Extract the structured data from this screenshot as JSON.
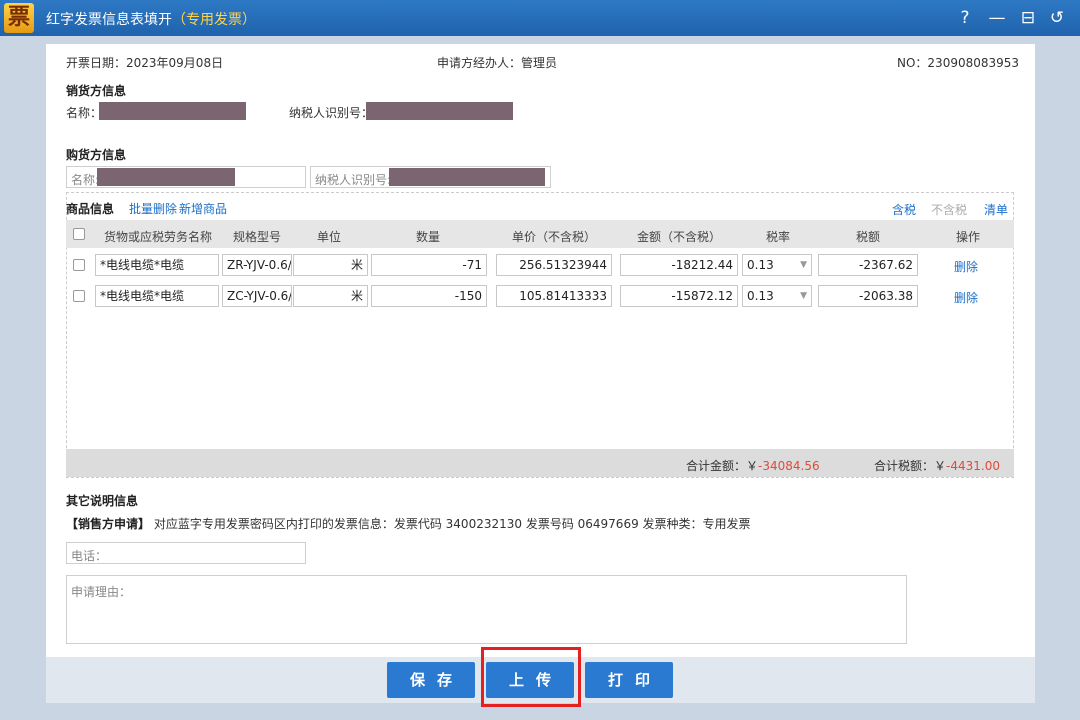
{
  "window": {
    "logo_char": "票",
    "title": "红字发票信息表填开",
    "title_sub": "（专用发票）",
    "help": "?",
    "minimize": "—",
    "restore": "⊟",
    "back": "↺"
  },
  "header": {
    "date": "开票日期：2023年09月08日",
    "applicant": "申请方经办人：管理员",
    "no": "NO：230908083953"
  },
  "seller": {
    "section": "销货方信息",
    "name_label": "名称：",
    "tax_label": "纳税人识别号："
  },
  "buyer": {
    "section": "购货方信息",
    "name_placeholder": "名称:",
    "tax_placeholder": "纳税人识别号:"
  },
  "goods": {
    "section": "商品信息",
    "batch_delete": "批量删除",
    "add_item": "新增商品",
    "with_tax": "含税",
    "without_tax": "不含税",
    "list": "清单",
    "columns": [
      "货物或应税劳务名称",
      "规格型号",
      "单位",
      "数量",
      "单价（不含税）",
      "金额（不含税）",
      "税率",
      "税额",
      "操作"
    ],
    "rows": [
      {
        "name": "*电线电缆*电缆",
        "spec": "ZR-YJV-0.6/",
        "unit": "米",
        "qty": "-71",
        "price": "256.51323944",
        "amount": "-18212.44",
        "rate": "0.13",
        "tax": "-2367.62",
        "action": "删除"
      },
      {
        "name": "*电线电缆*电缆",
        "spec": "ZC-YJV-0.6/",
        "unit": "米",
        "qty": "-150",
        "price": "105.81413333",
        "amount": "-15872.12",
        "rate": "0.13",
        "tax": "-2063.38",
        "action": "删除"
      }
    ],
    "total_amount_label": "合计金额：￥",
    "total_amount": "-34084.56",
    "total_tax_label": "合计税额：￥",
    "total_tax": "-4431.00"
  },
  "other": {
    "section": "其它说明信息",
    "seller_apply": "【销售方申请】",
    "desc": "对应蓝字专用发票密码区内打印的发票信息：发票代码 3400232130 发票号码 06497669 发票种类：专用发票",
    "phone_placeholder": "电话：",
    "reason_placeholder": "申请理由："
  },
  "buttons": {
    "save": "保存",
    "upload": "上传",
    "print": "打印"
  },
  "colors": {
    "titlebar": "#1f62ad",
    "accent": "#2a7ad2",
    "highlight": "#e52020",
    "negative": "#e04a3a"
  }
}
